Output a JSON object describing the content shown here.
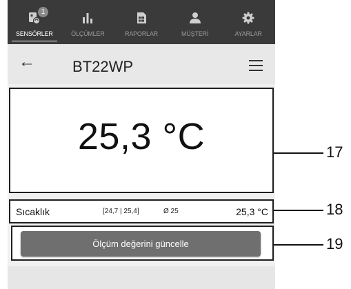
{
  "nav": {
    "items": [
      {
        "label": "SENSÖRLER",
        "icon": "sensor-icon",
        "active": true,
        "badge": "1"
      },
      {
        "label": "ÖLÇÜMLER",
        "icon": "bar-chart-icon",
        "active": false
      },
      {
        "label": "RAPORLAR",
        "icon": "report-icon",
        "active": false
      },
      {
        "label": "MÜŞTERİ",
        "icon": "customer-icon",
        "active": false
      },
      {
        "label": "AYARLAR",
        "icon": "gear-icon",
        "active": false
      }
    ]
  },
  "header": {
    "back_glyph": "←",
    "title": "BT22WP"
  },
  "measurement": {
    "value": "25,3 °C",
    "label": "Sıcaklık",
    "range": "[24,7 | 25,4]",
    "average": "Ø 25",
    "current": "25,3 °C"
  },
  "actions": {
    "update_label": "Ölçüm değerini güncelle"
  },
  "callouts": [
    "17",
    "18",
    "19"
  ],
  "colors": {
    "nav_bg": "#3a3a3a",
    "button_bg": "#6f6f6f",
    "title_bar": "#e8e8e8"
  }
}
